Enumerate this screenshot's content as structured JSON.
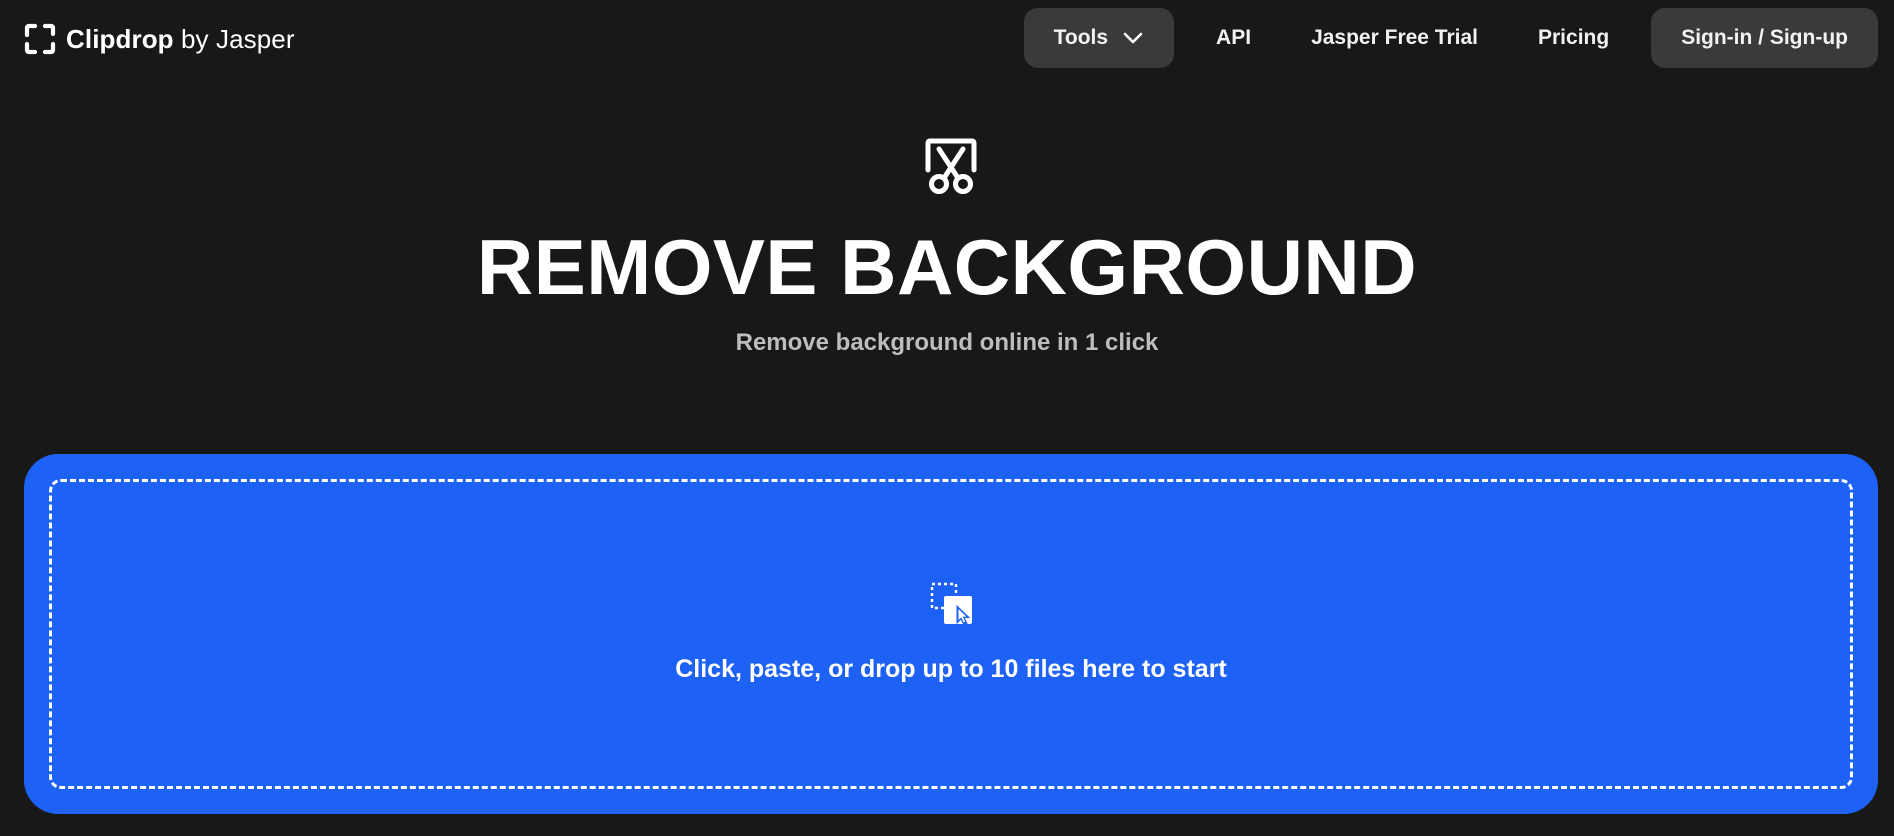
{
  "header": {
    "logo": {
      "brand": "Clipdrop",
      "suffix": "by Jasper",
      "icon": "clipdrop-bracket-icon"
    },
    "nav": {
      "tools_label": "Tools",
      "api_label": "API",
      "trial_label": "Jasper Free Trial",
      "pricing_label": "Pricing",
      "signin_label": "Sign-in / Sign-up"
    }
  },
  "hero": {
    "icon": "scissors-icon",
    "title": "REMOVE BACKGROUND",
    "subtitle": "Remove background online in 1 click"
  },
  "dropzone": {
    "icon": "upload-file-icon",
    "text": "Click, paste, or drop up to 10 files here to start"
  },
  "colors": {
    "background": "#181818",
    "accent": "#1e62f5",
    "nav_button": "#3a3a3a",
    "subtitle": "#bdbdbd"
  }
}
